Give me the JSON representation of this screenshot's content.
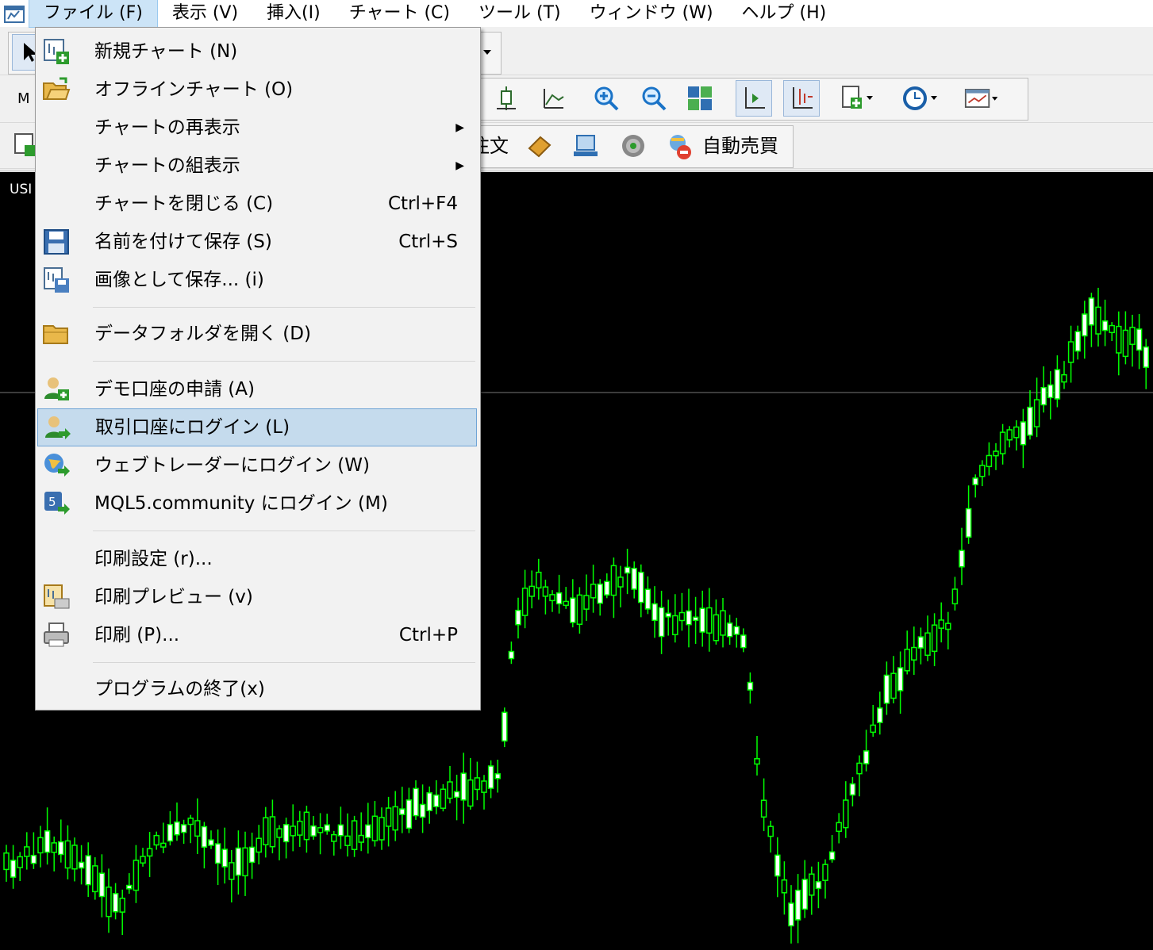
{
  "menubar": {
    "items": [
      "ファイル (F)",
      "表示 (V)",
      "挿入(I)",
      "チャート (C)",
      "ツール (T)",
      "ウィンドウ (W)",
      "ヘルプ (H)"
    ]
  },
  "toolbar": {
    "order_label": "注文",
    "auto_trade_label": "自動売買",
    "left_partial": "M"
  },
  "chart": {
    "symbol_partial": "USI",
    "background": "#000000",
    "candle_color": "#00ff00"
  },
  "file_menu": {
    "items": [
      {
        "label": "新規チャート (N)",
        "shortcut": "",
        "icon": "new-chart-icon"
      },
      {
        "label": "オフラインチャート (O)",
        "shortcut": "",
        "icon": "open-folder-icon"
      },
      {
        "label": "チャートの再表示",
        "shortcut": "",
        "submenu": true
      },
      {
        "label": "チャートの組表示",
        "shortcut": "",
        "submenu": true
      },
      {
        "label": "チャートを閉じる (C)",
        "shortcut": "Ctrl+F4"
      },
      {
        "label": "名前を付けて保存 (S)",
        "shortcut": "Ctrl+S",
        "icon": "save-icon"
      },
      {
        "label": "画像として保存... (i)",
        "shortcut": "",
        "icon": "save-image-icon"
      },
      {
        "label": "データフォルダを開く (D)",
        "shortcut": "",
        "icon": "folder-icon"
      },
      {
        "label": "デモ口座の申請 (A)",
        "shortcut": "",
        "icon": "add-user-icon"
      },
      {
        "label": "取引口座にログイン (L)",
        "shortcut": "",
        "icon": "login-user-icon"
      },
      {
        "label": "ウェブトレーダーにログイン (W)",
        "shortcut": "",
        "icon": "globe-login-icon"
      },
      {
        "label": "MQL5.community にログイン (M)",
        "shortcut": "",
        "icon": "mql5-login-icon"
      },
      {
        "label": "印刷設定 (r)...",
        "shortcut": ""
      },
      {
        "label": "印刷プレビュー (v)",
        "shortcut": "",
        "icon": "print-preview-icon"
      },
      {
        "label": "印刷 (P)...",
        "shortcut": "Ctrl+P",
        "icon": "printer-icon"
      },
      {
        "label": "プログラムの終了(x)",
        "shortcut": ""
      }
    ]
  }
}
